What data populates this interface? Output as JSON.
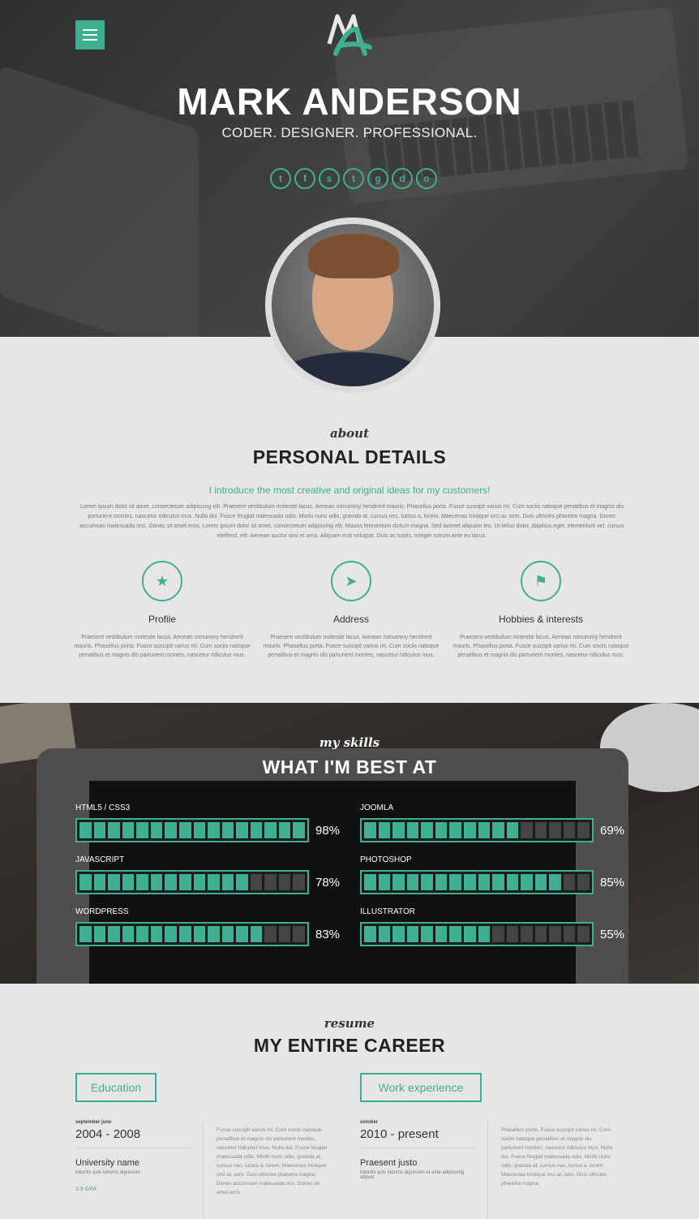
{
  "header": {
    "name": "MARK ANDERSON",
    "tagline": "CODER. DESIGNER. PROFESSIONAL.",
    "menu_icon": "hamburger-icon",
    "socials": [
      {
        "icon": "twitter-icon",
        "glyph": "t"
      },
      {
        "icon": "facebook-icon",
        "glyph": "f"
      },
      {
        "icon": "skype-icon",
        "glyph": "s"
      },
      {
        "icon": "tumblr-icon",
        "glyph": "t"
      },
      {
        "icon": "google-plus-icon",
        "glyph": "g"
      },
      {
        "icon": "dribbble-icon",
        "glyph": "d"
      },
      {
        "icon": "github-icon",
        "glyph": "o"
      }
    ],
    "accent": "#3eaf90"
  },
  "about": {
    "script": "about",
    "title": "PERSONAL DETAILS",
    "lead": "I introduce the most creative and original ideas for my customers!",
    "body": "Lorem ipsum dolor sit amet, consectetuer adipiscing elit. Praesent vestibulum molestie lacus. Aenean nonummy hendrerit mauris. Phasellus porta. Fusce suscipit varius mi. Cum sociis natoque penatibus et magnis dis parturient montes, nascetur ridiculus mus. Nulla dui. Fusce feugiat malesuada odio. Morbi nunc odio, gravida at, cursus nec, luctus a, lorem. Maecenas tristique orci ac sem. Duis ultricies pharetra magna. Donec accumsan malesuada orci. Donec sit amet eros. Lorem ipsum dolor sit amet, consectetuer adipiscing elit. Mauris fermentum dictum magna. Sed laoreet aliquam leo. Ut tellus dolor, dapibus eget, elementum vel, cursus eleifend, elit. Aenean auctor wisi et urna. Aliquam erat volutpat. Duis ac turpis. Integer rutrum ante eu lacus.",
    "features": [
      {
        "icon": "star-icon",
        "glyph": "★",
        "label": "Profile",
        "text": "Praesent vestibulum molestie lacus. Aenean nonummy hendrerit mauris. Phasellus porta. Fusce suscipit varius mi. Cum sociis natoque penatibus et magnis dis parturient montes, nascetur ridiculus mus."
      },
      {
        "icon": "location-arrow-icon",
        "glyph": "➤",
        "label": "Address",
        "text": "Praesent vestibulum molestie lacus. Aenean nonummy hendrerit mauris. Phasellus porta. Fusce suscipit varius mi. Cum sociis natoque penatibus et magnis dis parturient montes, nascetur ridiculus mus."
      },
      {
        "icon": "flag-icon",
        "glyph": "⚑",
        "label": "Hobbies & interests",
        "text": "Praesent vestibulum molestie lacus. Aenean nonummy hendrerit mauris. Phasellus porta. Fusce suscipit varius mi. Cum sociis natoque penatibus et magnis dis parturient montes, nascetur ridiculus mus."
      }
    ]
  },
  "skills": {
    "script": "my skills",
    "title": "WHAT I'M BEST AT",
    "items": [
      {
        "label": "HTML5 / CSS3",
        "percent": 98,
        "percent_label": "98%"
      },
      {
        "label": "JOOMLA",
        "percent": 69,
        "percent_label": "69%"
      },
      {
        "label": "JAVASCRIPT",
        "percent": 78,
        "percent_label": "78%"
      },
      {
        "label": "PHOTOSHOP",
        "percent": 85,
        "percent_label": "85%"
      },
      {
        "label": "WORDPRESS",
        "percent": 83,
        "percent_label": "83%"
      },
      {
        "label": "ILLUSTRATOR",
        "percent": 55,
        "percent_label": "55%"
      }
    ]
  },
  "career": {
    "script": "resume",
    "title": "MY ENTIRE CAREER",
    "education_label": "Education",
    "work_label": "Work experience",
    "education": {
      "months": "september     june",
      "years": "2004 - 2008",
      "place": "University name",
      "sub": "lobortis quis lobortis dignissim",
      "gpa": "3.9 GPA",
      "desc": "Fusce suscipit varius mi. Cum sociis natoque penatibus et magnis dis parturient montes, nascetur ridiculus mus. Nulla dui. Fusce feugiat malesuada odio. Morbi nunc odio, gravida at, cursus nec, luctus a, lorem. Maecenas tristique orci ac sem. Duis ultricies pharetra magna. Donec accumsan malesuada orci. Donec sit amet eros."
    },
    "work": {
      "months": "october",
      "years": "2010 - present",
      "place": "Praesent justo",
      "sub": "lobortis quis lobortis dignissim et ante adipiscing aliquet",
      "desc": "Phasellus porta. Fusce suscipit varius mi. Cum sociis natoque penatibus et magnis dis parturient montes, nascetur ridiculus mus. Nulla dui. Fusce feugiat malesuada odio. Morbi nunc odio, gravida at, cursus nec, luctus a, lorem. Maecenas tristique orci ac sem. Duis ultricies pharetra magna."
    }
  }
}
